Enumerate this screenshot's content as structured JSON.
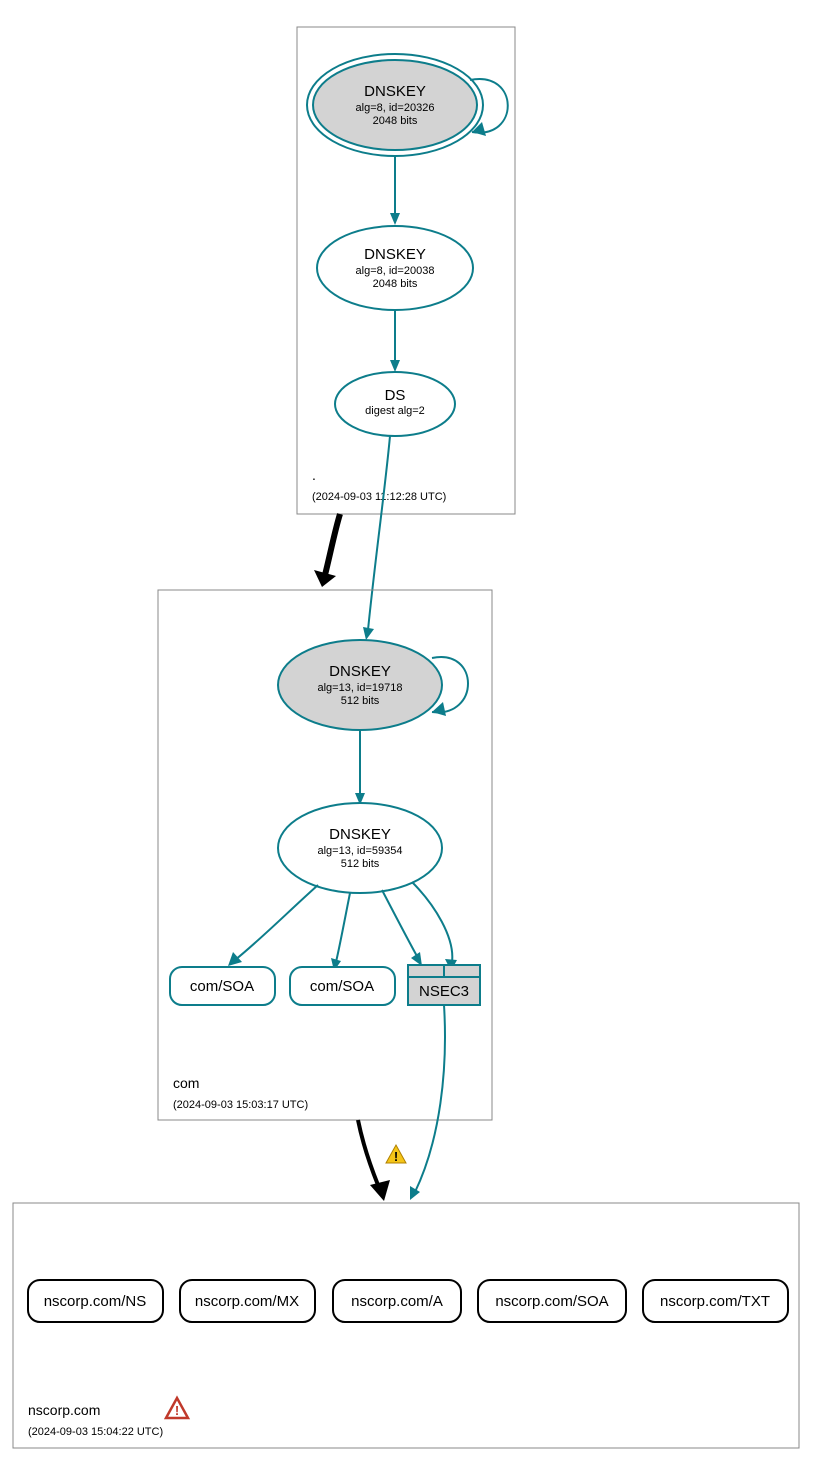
{
  "zones": {
    "root": {
      "label": ".",
      "timestamp": "(2024-09-03 11:12:28 UTC)"
    },
    "com": {
      "label": "com",
      "timestamp": "(2024-09-03 15:03:17 UTC)"
    },
    "nscorp": {
      "label": "nscorp.com",
      "timestamp": "(2024-09-03 15:04:22 UTC)"
    }
  },
  "nodes": {
    "root_ksk": {
      "title": "DNSKEY",
      "line1": "alg=8, id=20326",
      "line2": "2048 bits"
    },
    "root_zsk": {
      "title": "DNSKEY",
      "line1": "alg=8, id=20038",
      "line2": "2048 bits"
    },
    "root_ds": {
      "title": "DS",
      "line1": "digest alg=2"
    },
    "com_ksk": {
      "title": "DNSKEY",
      "line1": "alg=13, id=19718",
      "line2": "512 bits"
    },
    "com_zsk": {
      "title": "DNSKEY",
      "line1": "alg=13, id=59354",
      "line2": "512 bits"
    },
    "com_soa1": {
      "label": "com/SOA"
    },
    "com_soa2": {
      "label": "com/SOA"
    },
    "nsec3": {
      "label": "NSEC3"
    },
    "ns": {
      "label": "nscorp.com/NS"
    },
    "mx": {
      "label": "nscorp.com/MX"
    },
    "a": {
      "label": "nscorp.com/A"
    },
    "soa": {
      "label": "nscorp.com/SOA"
    },
    "txt": {
      "label": "nscorp.com/TXT"
    }
  }
}
